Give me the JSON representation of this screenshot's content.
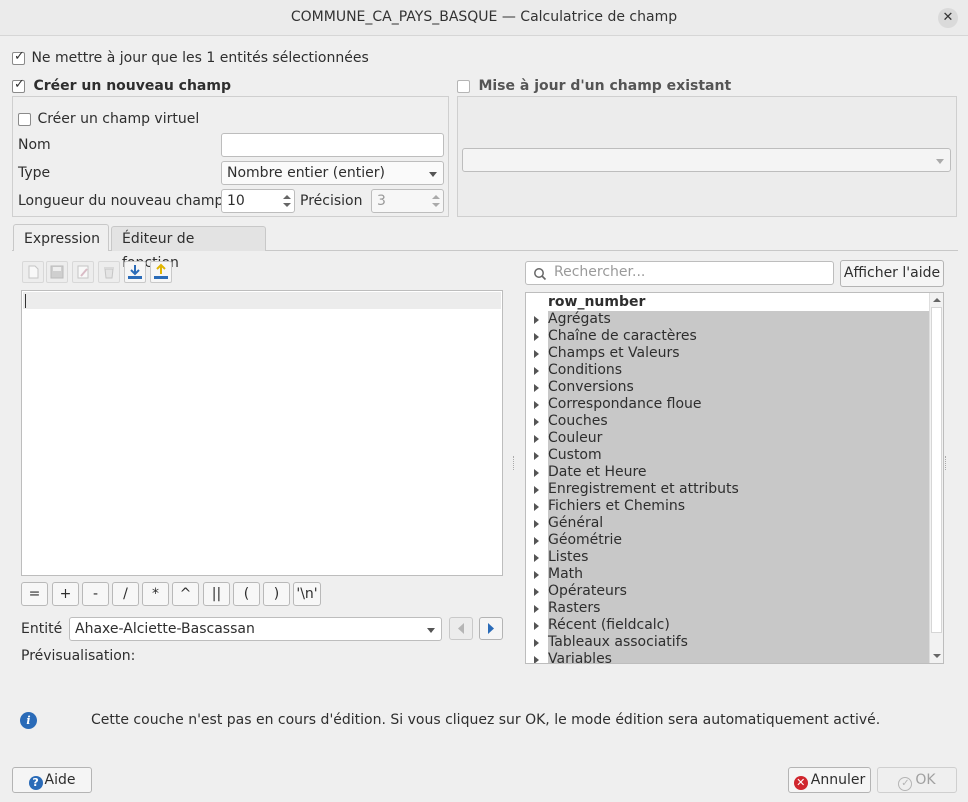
{
  "window": {
    "title": "COMMUNE_CA_PAYS_BASQUE — Calculatrice de champ"
  },
  "options": {
    "only_selected": "Ne mettre à jour que les 1 entités sélectionnées",
    "create_new_field": "Créer un nouveau champ",
    "update_existing_field": "Mise à jour d'un champ existant"
  },
  "new_field": {
    "virtual_label": "Créer un champ virtuel",
    "name_label": "Nom",
    "name_value": "",
    "type_label": "Type",
    "type_value": "Nombre entier (entier)",
    "length_label": "Longueur du nouveau champ",
    "length_value": "10",
    "precision_label": "Précision",
    "precision_value": "3"
  },
  "tabs": {
    "expression": "Expression",
    "function_editor": "Éditeur de fonction"
  },
  "toolbar_icons": [
    "new-file-icon",
    "save-icon",
    "edit-icon",
    "delete-icon",
    "import-icon",
    "export-icon"
  ],
  "operators": [
    "=",
    "+",
    "-",
    "/",
    "*",
    "^",
    "||",
    "(",
    ")",
    "'\\n'"
  ],
  "entity": {
    "label": "Entité",
    "value": "Ahaxe-Alciette-Bascassan"
  },
  "preview": {
    "label": "Prévisualisation:"
  },
  "search": {
    "placeholder": "Rechercher...",
    "help_button": "Afficher l'aide"
  },
  "tree": {
    "items": [
      "row_number",
      "Agrégats",
      "Chaîne de caractères",
      "Champs et Valeurs",
      "Conditions",
      "Conversions",
      "Correspondance floue",
      "Couches",
      "Couleur",
      "Custom",
      "Date et Heure",
      "Enregistrement et attributs",
      "Fichiers et Chemins",
      "Général",
      "Géométrie",
      "Listes",
      "Math",
      "Opérateurs",
      "Rasters",
      "Récent (fieldcalc)",
      "Tableaux associatifs",
      "Variables"
    ]
  },
  "message": "Cette couche n'est pas en cours d'édition. Si vous cliquez sur OK, le mode édition sera automatiquement activé.",
  "buttons": {
    "help": "Aide",
    "cancel": "Annuler",
    "ok": "OK"
  }
}
